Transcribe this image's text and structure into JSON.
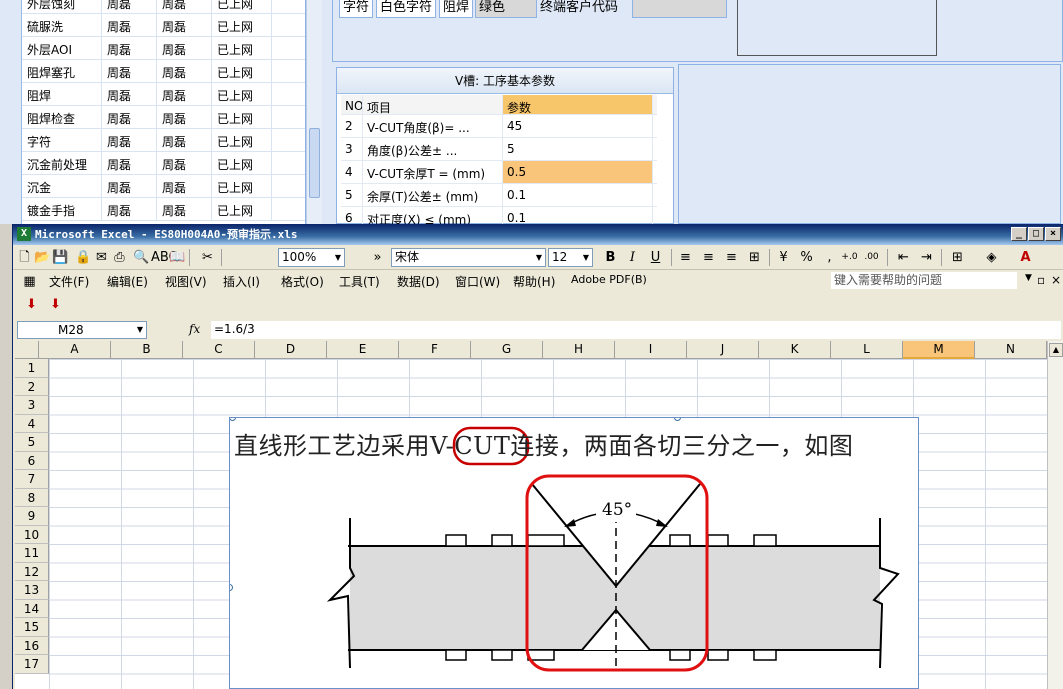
{
  "background_app": {
    "list_rows": [
      [
        "外层蚀刻",
        "周磊",
        "周磊",
        "已上网"
      ],
      [
        "硫脲洗",
        "周磊",
        "周磊",
        "已上网"
      ],
      [
        "外层AOI",
        "周磊",
        "周磊",
        "已上网"
      ],
      [
        "阻焊塞孔",
        "周磊",
        "周磊",
        "已上网"
      ],
      [
        "阻焊",
        "周磊",
        "周磊",
        "已上网"
      ],
      [
        "阻焊检查",
        "周磊",
        "周磊",
        "已上网"
      ],
      [
        "字符",
        "周磊",
        "周磊",
        "已上网"
      ],
      [
        "沉金前处理",
        "周磊",
        "周磊",
        "已上网"
      ],
      [
        "沉金",
        "周磊",
        "周磊",
        "已上网"
      ],
      [
        "镀金手指",
        "周磊",
        "周磊",
        "已上网"
      ]
    ],
    "tabs": [
      "字符",
      "白色字符",
      "阻焊",
      "绿色",
      "终端客户代码"
    ],
    "vpanel": {
      "title": "V槽: 工序基本参数",
      "headers": [
        "NO",
        "项目",
        "参数"
      ],
      "rows": [
        [
          "2",
          "V-CUT角度(β)=  ...",
          "45"
        ],
        [
          "3",
          "角度(β)公差±   ...",
          "5"
        ],
        [
          "4",
          "V-CUT余厚T = (mm)",
          "0.5"
        ],
        [
          "5",
          "余厚(T)公差±  (mm)",
          "0.1"
        ],
        [
          "6",
          "对正度(X) ≤ (mm)",
          "0.1"
        ]
      ]
    }
  },
  "excel": {
    "title": "Microsoft Excel - ES80H004A0-预审指示.xls",
    "zoom": "100%",
    "font_name": "宋体",
    "font_size": "12",
    "menu": [
      "文件(F)",
      "编辑(E)",
      "视图(V)",
      "插入(I)",
      "格式(O)",
      "工具(T)",
      "数据(D)",
      "窗口(W)",
      "帮助(H)",
      "Adobe PDF(B)"
    ],
    "help_placeholder": "键入需要帮助的问题",
    "name_box": "M28",
    "formula": "=1.6/3",
    "columns": [
      "A",
      "B",
      "C",
      "D",
      "E",
      "F",
      "G",
      "H",
      "I",
      "J",
      "K",
      "L",
      "M",
      "N"
    ],
    "active_column": "M",
    "rows": [
      "1",
      "2",
      "3",
      "4",
      "5",
      "6",
      "7",
      "8",
      "9",
      "10",
      "11",
      "12",
      "13",
      "14",
      "15",
      "16",
      "17"
    ],
    "picture": {
      "caption": "直线形工艺边采用V-CUT连接，两面各切三分之一，如图",
      "angle_label": "45°"
    }
  }
}
